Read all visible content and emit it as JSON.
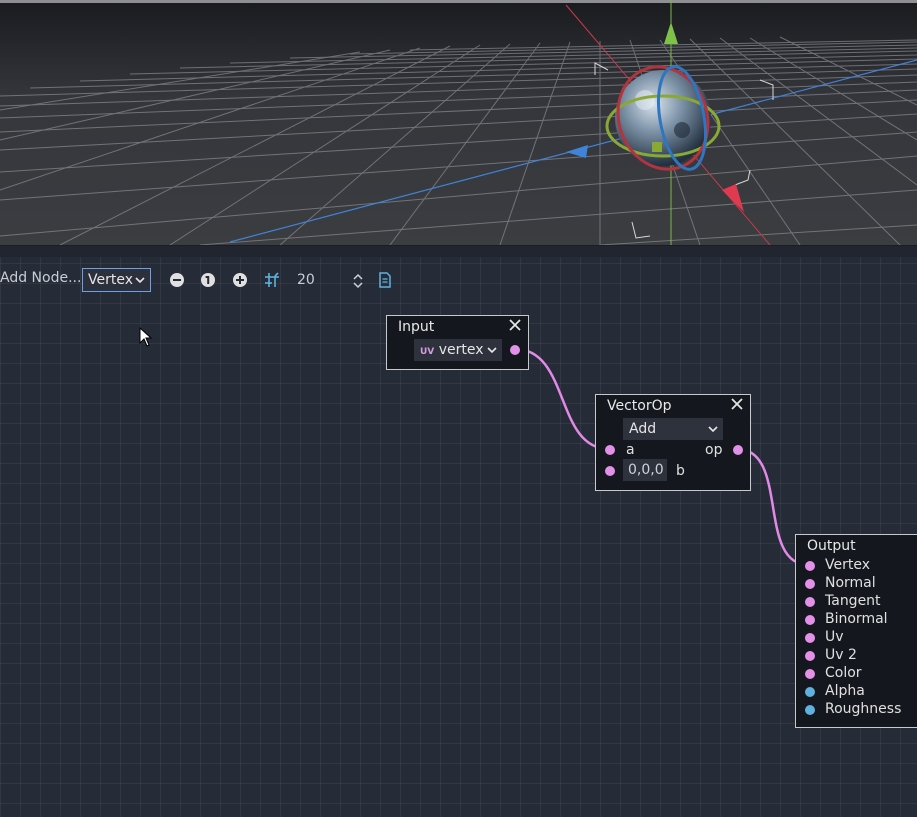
{
  "toolbar": {
    "add_node_label": "Add Node...",
    "mode_value": "Vertex",
    "snap_value": "20",
    "icons": [
      "zoom-out-icon",
      "zoom-reset-icon",
      "zoom-in-icon",
      "snap-grid-icon",
      "spinner-icon",
      "document-icon"
    ]
  },
  "nodes": {
    "input": {
      "title": "Input",
      "dropdown_value": "vertex",
      "dropdown_icon": "uv-icon"
    },
    "vectorop": {
      "title": "VectorOp",
      "operation_value": "Add",
      "port_a_label": "a",
      "port_b_value": "0,0,0",
      "port_b_label": "b",
      "output_label": "op"
    },
    "output": {
      "title": "Output",
      "ports": [
        "Vertex",
        "Normal",
        "Tangent",
        "Binormal",
        "Uv",
        "Uv 2",
        "Color",
        "Alpha",
        "Roughness"
      ]
    }
  },
  "colors": {
    "vector_port": "#e290e8",
    "scalar_port": "#5fb1de",
    "wire": "#e08ae6",
    "graph_bg": "#262b38",
    "selection_accent": "#6aa3e0"
  }
}
